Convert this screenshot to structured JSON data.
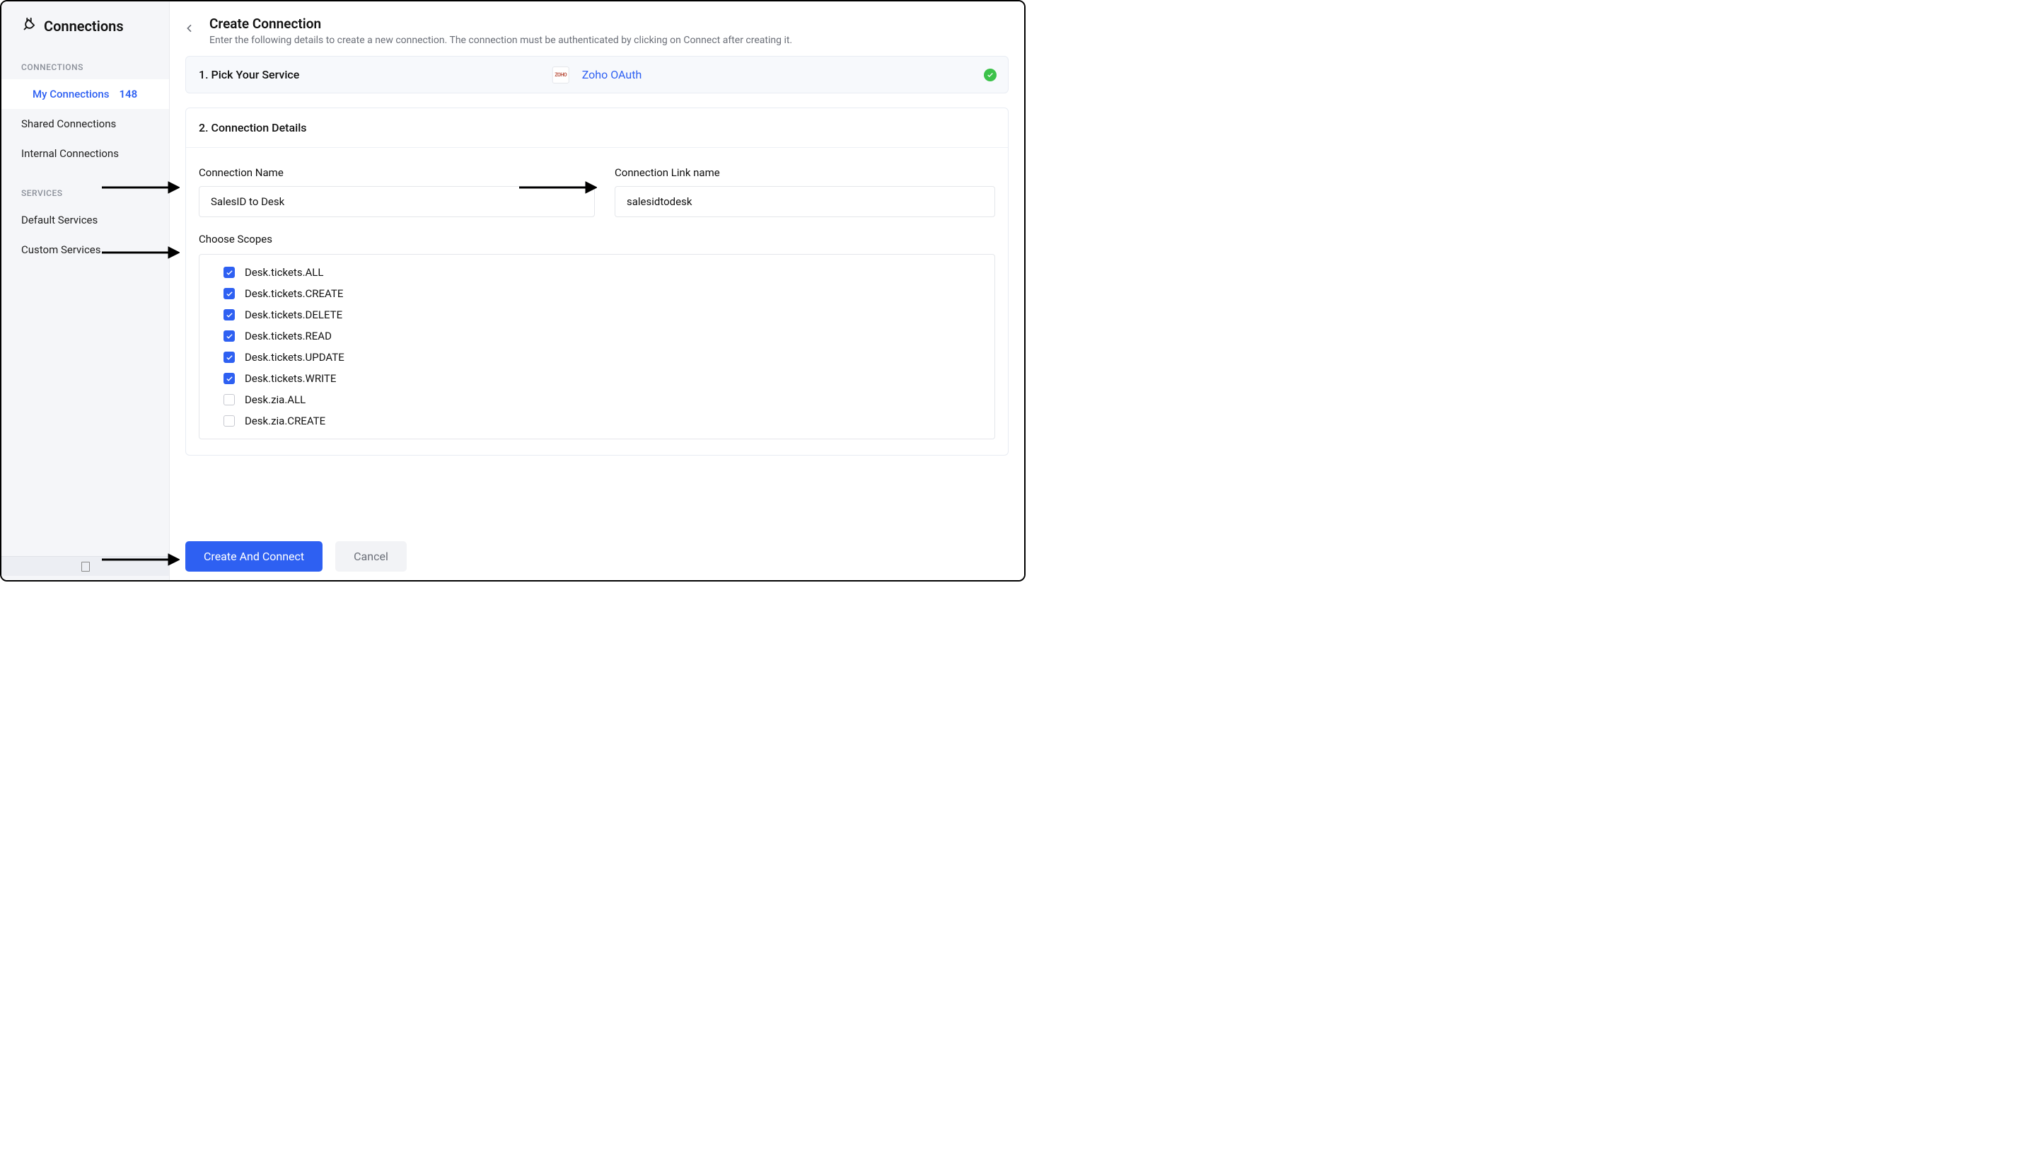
{
  "sidebar": {
    "title": "Connections",
    "groups": {
      "connections_label": "CONNECTIONS",
      "services_label": "SERVICES"
    },
    "items": {
      "my_connections": {
        "label": "My Connections",
        "badge": "148"
      },
      "shared_connections": {
        "label": "Shared Connections"
      },
      "internal_connections": {
        "label": "Internal Connections"
      },
      "default_services": {
        "label": "Default Services"
      },
      "custom_services": {
        "label": "Custom Services"
      }
    }
  },
  "header": {
    "title": "Create Connection",
    "subtitle": "Enter the following details to create a new connection. The connection must be authenticated by clicking on Connect after creating it."
  },
  "step1": {
    "title": "1. Pick Your Service",
    "service_name": "Zoho OAuth",
    "service_icon_text": "ZOHO"
  },
  "step2": {
    "title": "2. Connection Details",
    "fields": {
      "connection_name": {
        "label": "Connection Name",
        "value": "SalesID to Desk"
      },
      "connection_link_name": {
        "label": "Connection Link name",
        "value": "salesidtodesk"
      }
    },
    "scopes_label": "Choose Scopes",
    "scopes": [
      {
        "label": "Desk.tickets.ALL",
        "checked": true
      },
      {
        "label": "Desk.tickets.CREATE",
        "checked": true
      },
      {
        "label": "Desk.tickets.DELETE",
        "checked": true
      },
      {
        "label": "Desk.tickets.READ",
        "checked": true
      },
      {
        "label": "Desk.tickets.UPDATE",
        "checked": true
      },
      {
        "label": "Desk.tickets.WRITE",
        "checked": true
      },
      {
        "label": "Desk.zia.ALL",
        "checked": false
      },
      {
        "label": "Desk.zia.CREATE",
        "checked": false
      }
    ]
  },
  "buttons": {
    "primary": "Create And Connect",
    "secondary": "Cancel"
  }
}
